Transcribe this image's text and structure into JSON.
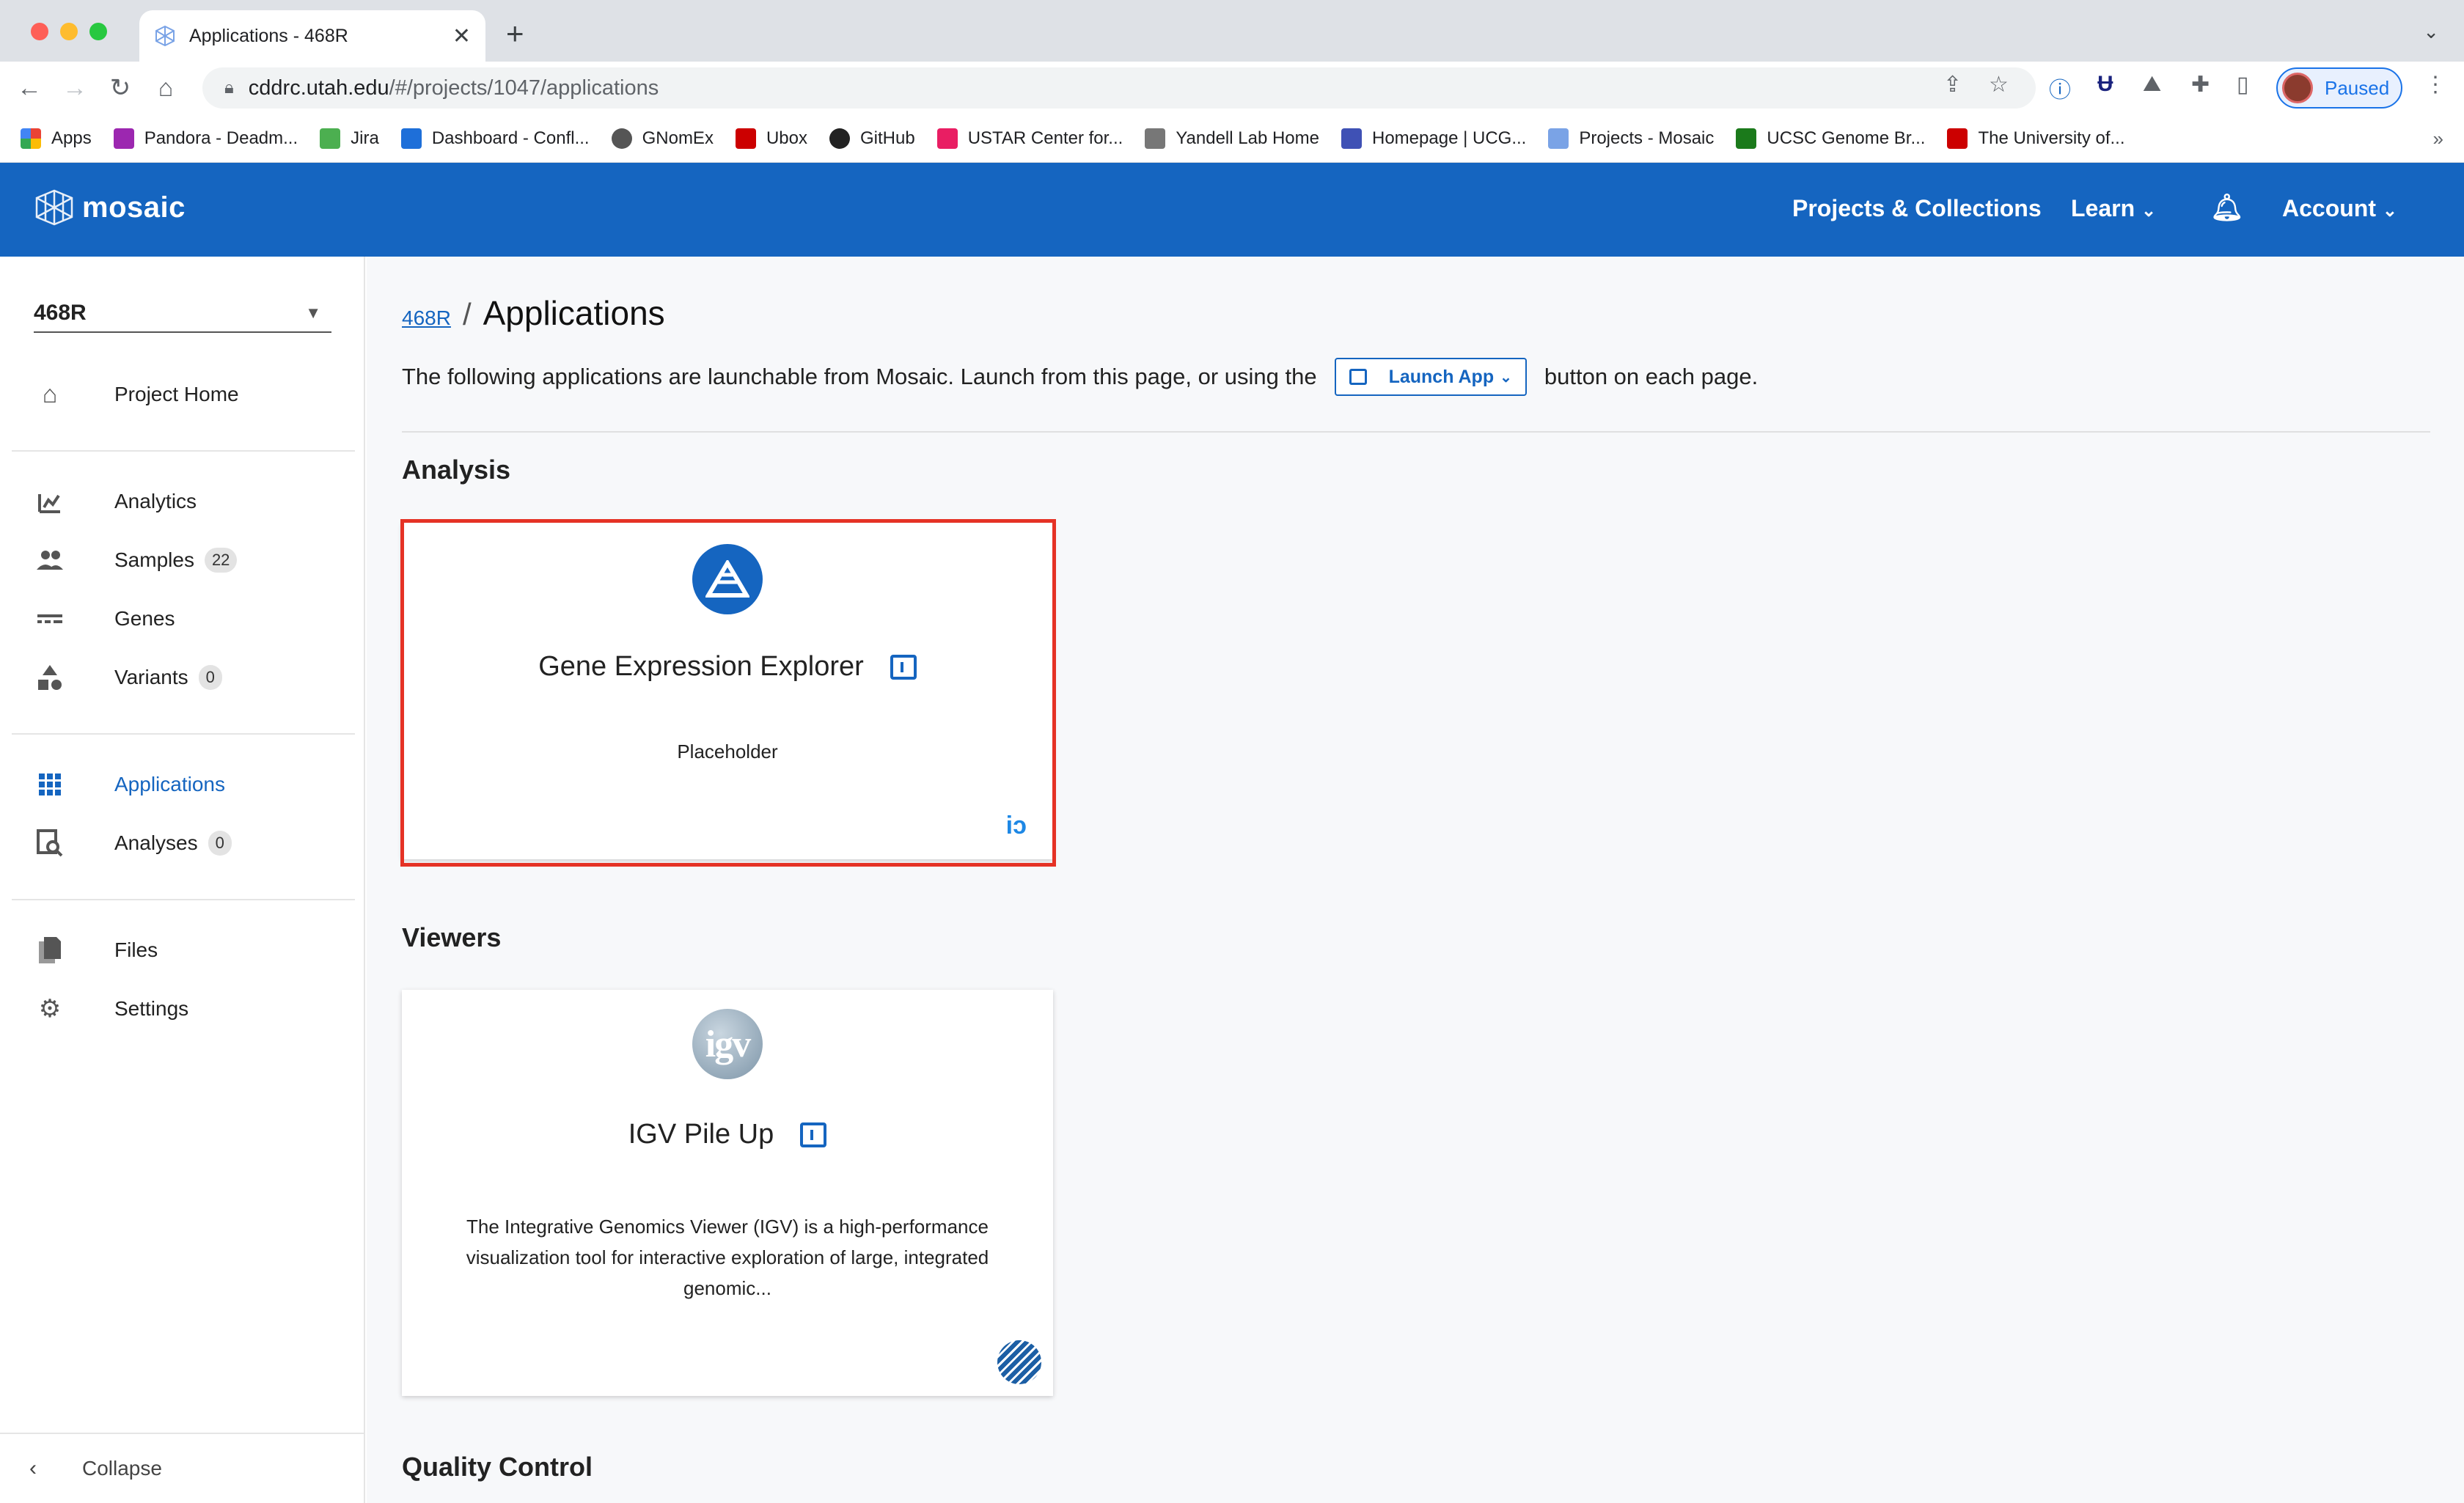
{
  "browser": {
    "tab_title": "Applications - 468R",
    "url_host": "cddrc.utah.edu",
    "url_path": "/#/projects/1047/applications",
    "profile_label": "Paused",
    "bookmarks": [
      {
        "label": "Apps",
        "color": "#ea4335"
      },
      {
        "label": "Pandora - Deadm...",
        "color": "#9c27b0"
      },
      {
        "label": "Jira",
        "color": "#4caf50"
      },
      {
        "label": "Dashboard - Confl...",
        "color": "#1e6fd9"
      },
      {
        "label": "GNomEx",
        "color": "#555555"
      },
      {
        "label": "Ubox",
        "color": "#cc0000"
      },
      {
        "label": "GitHub",
        "color": "#222222"
      },
      {
        "label": "USTAR Center for...",
        "color": "#e91e63"
      },
      {
        "label": "Yandell Lab Home",
        "color": "#777777"
      },
      {
        "label": "Homepage | UCG...",
        "color": "#3f51b5"
      },
      {
        "label": "Projects - Mosaic",
        "color": "#7aa3e6"
      },
      {
        "label": "UCSC Genome Br...",
        "color": "#1b7a1b"
      },
      {
        "label": "The University of...",
        "color": "#cc0000"
      }
    ]
  },
  "appbar": {
    "logo": "mosaic",
    "nav_projects": "Projects & Collections",
    "nav_learn": "Learn",
    "nav_account": "Account",
    "color": "#1565c0"
  },
  "sidebar": {
    "project": "468R",
    "items": [
      {
        "label": "Project Home",
        "icon": "home-icon"
      },
      {
        "label": "Analytics",
        "icon": "analytics-icon"
      },
      {
        "label": "Samples",
        "badge": "22",
        "icon": "people-icon"
      },
      {
        "label": "Genes",
        "icon": "genes-icon"
      },
      {
        "label": "Variants",
        "badge": "0",
        "icon": "shapes-icon"
      },
      {
        "label": "Applications",
        "icon": "grid-icon"
      },
      {
        "label": "Analyses",
        "badge": "0",
        "icon": "search-doc-icon"
      },
      {
        "label": "Files",
        "icon": "files-icon"
      },
      {
        "label": "Settings",
        "icon": "gear-icon"
      }
    ],
    "collapse": "Collapse"
  },
  "main": {
    "breadcrumb_link": "468R",
    "title": "Applications",
    "intro_before": "The following applications are launchable from Mosaic. Launch from this page, or using the",
    "launch_button": "Launch App",
    "intro_after": "button on each page.",
    "sections": {
      "analysis": "Analysis",
      "viewers": "Viewers",
      "quality": "Quality Control"
    },
    "cards": {
      "gene": {
        "title": "Gene Expression Explorer",
        "description": "Placeholder"
      },
      "igv": {
        "title": "IGV Pile Up",
        "description": "The Integrative Genomics Viewer (IGV) is a high-performance visualization tool for interactive exploration of large, integrated genomic..."
      }
    }
  }
}
